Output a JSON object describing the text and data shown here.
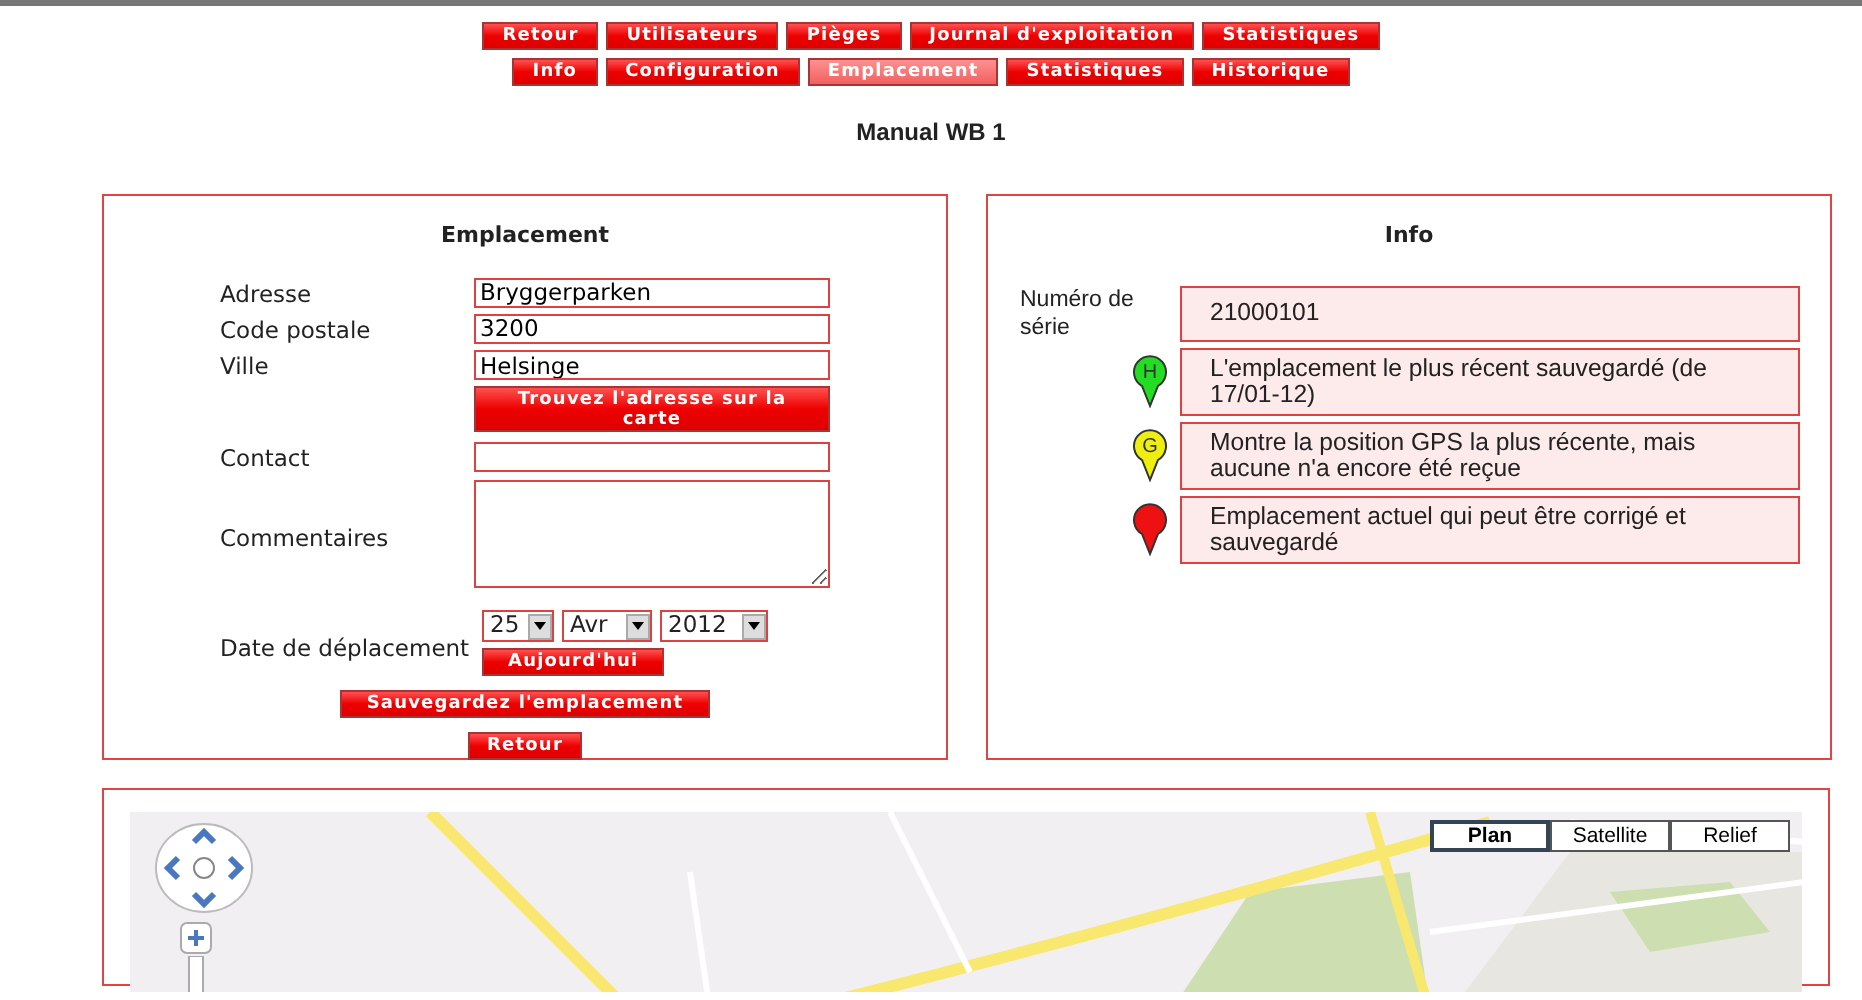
{
  "nav_rows": [
    [
      {
        "label": "Retour",
        "selected": false
      },
      {
        "label": "Utilisateurs",
        "selected": false
      },
      {
        "label": "Pièges",
        "selected": false
      },
      {
        "label": "Journal d'exploitation",
        "selected": false
      },
      {
        "label": "Statistiques",
        "selected": false
      }
    ],
    [
      {
        "label": "Info",
        "selected": false
      },
      {
        "label": "Configuration",
        "selected": false
      },
      {
        "label": "Emplacement",
        "selected": true
      },
      {
        "label": "Statistiques",
        "selected": false
      },
      {
        "label": "Historique",
        "selected": false
      }
    ]
  ],
  "page_title": "Manual WB 1",
  "location_panel": {
    "title": "Emplacement",
    "fields": [
      {
        "label": "Adresse",
        "value": "Bryggerparken",
        "kind": "text"
      },
      {
        "label": "Code postale",
        "value": "3200",
        "kind": "text"
      },
      {
        "label": "Ville",
        "value": "Helsinge",
        "kind": "text"
      },
      {
        "kind": "button",
        "button": "Trouvez l'adresse sur la carte"
      },
      {
        "label": "Contact",
        "kind": "text"
      },
      {
        "label": "Commentaires",
        "kind": "textarea"
      },
      {
        "label": "Date de déplacement",
        "kind": "date",
        "day": "25",
        "month": "Avr",
        "year": "2012",
        "button": "Aujourd'hui"
      }
    ],
    "save_button": "Sauvegardez l'emplacement",
    "back_button": "Retour"
  },
  "info_panel": {
    "title": "Info",
    "serial_label": "Numéro de série",
    "serial": "21000101",
    "legend": [
      {
        "marker_label": "H",
        "color": "#22dd22",
        "text": "L'emplacement le plus récent sauvegardé (de 17/01-12)"
      },
      {
        "marker_label": "G",
        "color": "#eeee11",
        "text": "Montre la position GPS la plus récente, mais aucune n'a encore été reçue"
      },
      {
        "color": "#ee1111",
        "text": "Emplacement actuel qui peut être corrigé et sauvegardé"
      }
    ]
  },
  "map": {
    "kind": "picture",
    "map_types": [
      {
        "label": "Plan",
        "selected": true
      },
      {
        "label": "Satellite",
        "selected": false
      },
      {
        "label": "Relief",
        "selected": false
      }
    ]
  }
}
